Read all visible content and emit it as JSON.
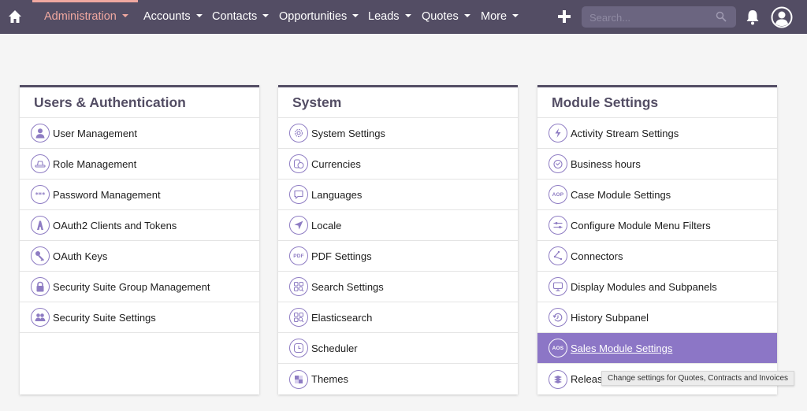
{
  "navbar": {
    "home_icon": "home-icon",
    "items": [
      {
        "label": "Administration",
        "active": true
      },
      {
        "label": "Accounts",
        "active": false
      },
      {
        "label": "Contacts",
        "active": false
      },
      {
        "label": "Opportunities",
        "active": false
      },
      {
        "label": "Leads",
        "active": false
      },
      {
        "label": "Quotes",
        "active": false
      },
      {
        "label": "More",
        "active": false
      }
    ],
    "create_icon": "plus-icon",
    "search": {
      "placeholder": "Search...",
      "value": ""
    },
    "notifications_icon": "bell-icon",
    "profile_icon": "user-circle-icon"
  },
  "panels": [
    {
      "title": "Users & Authentication",
      "items": [
        {
          "label": "User Management",
          "icon": "user-icon"
        },
        {
          "label": "Role Management",
          "icon": "hat-icon"
        },
        {
          "label": "Password Management",
          "icon": "password-icon"
        },
        {
          "label": "OAuth2 Clients and Tokens",
          "icon": "oauth2-icon"
        },
        {
          "label": "OAuth Keys",
          "icon": "key-icon"
        },
        {
          "label": "Security Suite Group Management",
          "icon": "lock-icon"
        },
        {
          "label": "Security Suite Settings",
          "icon": "users-icon"
        }
      ]
    },
    {
      "title": "System",
      "items": [
        {
          "label": "System Settings",
          "icon": "gear-icon"
        },
        {
          "label": "Currencies",
          "icon": "coins-icon"
        },
        {
          "label": "Languages",
          "icon": "speech-bubble-icon"
        },
        {
          "label": "Locale",
          "icon": "location-arrow-icon"
        },
        {
          "label": "PDF Settings",
          "icon": "pdf-icon",
          "icon_text": "PDF"
        },
        {
          "label": "Search Settings",
          "icon": "search-settings-icon"
        },
        {
          "label": "Elasticsearch",
          "icon": "elasticsearch-icon"
        },
        {
          "label": "Scheduler",
          "icon": "clock-icon"
        },
        {
          "label": "Themes",
          "icon": "themes-icon"
        }
      ]
    },
    {
      "title": "Module Settings",
      "items": [
        {
          "label": "Activity Stream Settings",
          "icon": "lightning-icon"
        },
        {
          "label": "Business hours",
          "icon": "alarm-clock-icon"
        },
        {
          "label": "Case Module Settings",
          "icon": "aop-icon",
          "icon_text": "AOP"
        },
        {
          "label": "Configure Module Menu Filters",
          "icon": "sliders-icon"
        },
        {
          "label": "Connectors",
          "icon": "connectors-icon"
        },
        {
          "label": "Display Modules and Subpanels",
          "icon": "monitor-icon"
        },
        {
          "label": "History Subpanel",
          "icon": "history-icon"
        },
        {
          "label": "Sales Module Settings",
          "icon": "aos-icon",
          "icon_text": "AOS",
          "selected": true
        },
        {
          "label": "Releases",
          "icon": "layers-icon"
        }
      ]
    }
  ],
  "tooltip": {
    "text": "Change settings for Quotes, Contracts and Invoices"
  },
  "colors": {
    "navbar_bg": "#534d64",
    "active_nav": "#f0a8a0",
    "accent": "#8c76c6",
    "icon": "#8e7cc3"
  }
}
